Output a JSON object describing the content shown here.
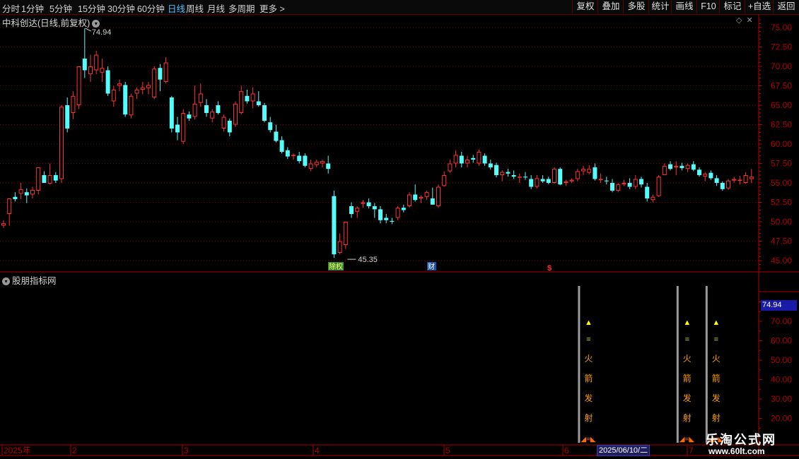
{
  "toolbar": {
    "periods": [
      "分时",
      "1分钟",
      "5分钟",
      "15分钟",
      "30分钟",
      "60分钟",
      "日线",
      "周线",
      "月线",
      "多周期",
      "更多"
    ],
    "active_period": "日线",
    "right_buttons": [
      "复权",
      "叠加",
      "多股",
      "统计",
      "画线",
      "F10",
      "标记",
      "+自选",
      "返回"
    ]
  },
  "main_chart": {
    "title": "中科创达(日线,前复权)"
  },
  "indicator_panel": {
    "title": "股朋指标网",
    "current_value_box": "74.94",
    "yticks": [
      "70.00",
      "60.00",
      "50.00",
      "40.00",
      "30.00",
      "20.00"
    ],
    "signal_text": [
      "▲",
      "=",
      "火",
      "箭",
      "发",
      "射"
    ],
    "signal_footer": "◢=◣"
  },
  "date_axis": {
    "labels": [
      "2025年",
      "2",
      "3",
      "4",
      "5",
      "6",
      "7"
    ],
    "cursor_date": "2025/06/10/二"
  },
  "watermark": {
    "main": "乐淘公式网",
    "url": "www.60lt.com"
  },
  "colors": {
    "up": "#ff3232",
    "down": "#54fcfc",
    "grid": "#8a0000",
    "axis": "#b00000",
    "text": "#c8c8c8",
    "signal_yellow": "#ffff00",
    "signal_orange": "#ffa000"
  },
  "chart_data": {
    "type": "candlestick",
    "title": "中科创达(日线,前复权)",
    "y_range": [
      44.0,
      76.5
    ],
    "yticks": [
      "75.00",
      "72.50",
      "70.00",
      "67.50",
      "65.00",
      "62.50",
      "60.00",
      "57.50",
      "55.00",
      "52.50",
      "50.00",
      "47.50",
      "45.00"
    ],
    "annotations": {
      "high_label": "74.94",
      "low_label": "45.35",
      "event_markers": [
        "除权",
        "财",
        "$"
      ]
    },
    "signals_at_index": [
      102,
      119,
      124
    ],
    "candles": [
      {
        "o": 49.5,
        "h": 50.2,
        "l": 49.2,
        "c": 49.8
      },
      {
        "o": 51.0,
        "h": 53.0,
        "l": 49.5,
        "c": 53.0
      },
      {
        "o": 53.2,
        "h": 53.8,
        "l": 52.6,
        "c": 52.9
      },
      {
        "o": 53.6,
        "h": 55.0,
        "l": 52.9,
        "c": 54.2
      },
      {
        "o": 53.8,
        "h": 54.3,
        "l": 52.4,
        "c": 53.4
      },
      {
        "o": 53.5,
        "h": 54.5,
        "l": 53.0,
        "c": 54.1
      },
      {
        "o": 54.0,
        "h": 57.0,
        "l": 53.5,
        "c": 57.0
      },
      {
        "o": 56.0,
        "h": 56.5,
        "l": 55.0,
        "c": 55.0
      },
      {
        "o": 54.9,
        "h": 57.5,
        "l": 54.8,
        "c": 56.0
      },
      {
        "o": 56.0,
        "h": 56.4,
        "l": 55.0,
        "c": 55.3
      },
      {
        "o": 55.5,
        "h": 65.0,
        "l": 55.0,
        "c": 64.8
      },
      {
        "o": 65.0,
        "h": 66.0,
        "l": 61.5,
        "c": 62.0
      },
      {
        "o": 64.0,
        "h": 66.8,
        "l": 63.2,
        "c": 66.2
      },
      {
        "o": 65.0,
        "h": 70.0,
        "l": 64.5,
        "c": 70.0
      },
      {
        "o": 71.0,
        "h": 74.9,
        "l": 68.5,
        "c": 69.5
      },
      {
        "o": 69.0,
        "h": 71.5,
        "l": 68.0,
        "c": 70.0
      },
      {
        "o": 69.5,
        "h": 72.0,
        "l": 69.0,
        "c": 71.5
      },
      {
        "o": 69.2,
        "h": 71.0,
        "l": 68.0,
        "c": 69.8
      },
      {
        "o": 69.5,
        "h": 70.0,
        "l": 66.2,
        "c": 66.5
      },
      {
        "o": 65.5,
        "h": 67.5,
        "l": 64.8,
        "c": 67.0
      },
      {
        "o": 67.5,
        "h": 68.3,
        "l": 66.8,
        "c": 67.8
      },
      {
        "o": 67.6,
        "h": 68.0,
        "l": 63.5,
        "c": 63.8
      },
      {
        "o": 63.7,
        "h": 66.5,
        "l": 63.3,
        "c": 66.2
      },
      {
        "o": 66.5,
        "h": 67.3,
        "l": 65.8,
        "c": 67.0
      },
      {
        "o": 67.0,
        "h": 68.0,
        "l": 66.4,
        "c": 67.3
      },
      {
        "o": 67.2,
        "h": 68.0,
        "l": 66.4,
        "c": 67.6
      },
      {
        "o": 66.0,
        "h": 70.0,
        "l": 65.8,
        "c": 69.7
      },
      {
        "o": 69.8,
        "h": 70.3,
        "l": 66.8,
        "c": 68.3
      },
      {
        "o": 68.0,
        "h": 71.2,
        "l": 67.8,
        "c": 70.5
      },
      {
        "o": 66.0,
        "h": 66.2,
        "l": 61.5,
        "c": 62.0
      },
      {
        "o": 62.5,
        "h": 63.5,
        "l": 60.5,
        "c": 61.5
      },
      {
        "o": 60.3,
        "h": 64.5,
        "l": 60.0,
        "c": 64.0
      },
      {
        "o": 63.8,
        "h": 64.2,
        "l": 63.0,
        "c": 63.3
      },
      {
        "o": 63.5,
        "h": 67.5,
        "l": 63.2,
        "c": 65.2
      },
      {
        "o": 65.3,
        "h": 67.8,
        "l": 64.8,
        "c": 66.5
      },
      {
        "o": 65.0,
        "h": 65.8,
        "l": 63.5,
        "c": 64.0
      },
      {
        "o": 63.3,
        "h": 64.5,
        "l": 62.8,
        "c": 64.2
      },
      {
        "o": 65.0,
        "h": 65.5,
        "l": 63.8,
        "c": 64.0
      },
      {
        "o": 62.0,
        "h": 63.8,
        "l": 61.6,
        "c": 63.5
      },
      {
        "o": 63.0,
        "h": 63.3,
        "l": 61.0,
        "c": 61.5
      },
      {
        "o": 62.5,
        "h": 65.5,
        "l": 62.2,
        "c": 65.2
      },
      {
        "o": 64.0,
        "h": 67.5,
        "l": 63.8,
        "c": 66.8
      },
      {
        "o": 66.2,
        "h": 67.0,
        "l": 65.2,
        "c": 65.5
      },
      {
        "o": 65.5,
        "h": 67.3,
        "l": 64.6,
        "c": 66.5
      },
      {
        "o": 65.5,
        "h": 66.8,
        "l": 64.8,
        "c": 65.0
      },
      {
        "o": 65.0,
        "h": 65.3,
        "l": 62.8,
        "c": 63.0
      },
      {
        "o": 62.8,
        "h": 63.5,
        "l": 61.5,
        "c": 61.8
      },
      {
        "o": 61.6,
        "h": 62.5,
        "l": 60.2,
        "c": 60.4
      },
      {
        "o": 60.5,
        "h": 61.0,
        "l": 58.8,
        "c": 59.0
      },
      {
        "o": 59.2,
        "h": 59.6,
        "l": 58.1,
        "c": 58.4
      },
      {
        "o": 58.5,
        "h": 58.8,
        "l": 58.0,
        "c": 58.6
      },
      {
        "o": 58.5,
        "h": 59.0,
        "l": 57.5,
        "c": 57.8
      },
      {
        "o": 58.5,
        "h": 58.8,
        "l": 57.0,
        "c": 57.2
      },
      {
        "o": 56.8,
        "h": 58.0,
        "l": 56.5,
        "c": 57.5
      },
      {
        "o": 57.3,
        "h": 58.0,
        "l": 57.0,
        "c": 57.7
      },
      {
        "o": 57.5,
        "h": 58.0,
        "l": 57.0,
        "c": 57.8
      },
      {
        "o": 57.5,
        "h": 58.5,
        "l": 56.2,
        "c": 56.8
      },
      {
        "o": 53.3,
        "h": 54.0,
        "l": 45.35,
        "c": 45.8
      },
      {
        "o": 46.0,
        "h": 48.5,
        "l": 45.8,
        "c": 47.5
      },
      {
        "o": 47.0,
        "h": 50.0,
        "l": 46.5,
        "c": 50.0
      },
      {
        "o": 52.0,
        "h": 52.5,
        "l": 50.5,
        "c": 51.0
      },
      {
        "o": 51.3,
        "h": 52.0,
        "l": 50.5,
        "c": 51.8
      },
      {
        "o": 52.3,
        "h": 52.8,
        "l": 51.8,
        "c": 52.5
      },
      {
        "o": 52.5,
        "h": 53.0,
        "l": 51.7,
        "c": 52.0
      },
      {
        "o": 52.0,
        "h": 52.4,
        "l": 50.5,
        "c": 51.6
      },
      {
        "o": 51.6,
        "h": 52.0,
        "l": 49.8,
        "c": 50.2
      },
      {
        "o": 50.5,
        "h": 51.0,
        "l": 49.8,
        "c": 50.2
      },
      {
        "o": 50.1,
        "h": 50.5,
        "l": 49.7,
        "c": 50.0
      },
      {
        "o": 50.5,
        "h": 52.0,
        "l": 50.2,
        "c": 51.8
      },
      {
        "o": 51.8,
        "h": 52.2,
        "l": 51.2,
        "c": 51.5
      },
      {
        "o": 52.0,
        "h": 53.8,
        "l": 51.8,
        "c": 53.5
      },
      {
        "o": 53.5,
        "h": 54.8,
        "l": 52.6,
        "c": 52.8
      },
      {
        "o": 53.0,
        "h": 53.4,
        "l": 52.4,
        "c": 53.2
      },
      {
        "o": 53.2,
        "h": 54.0,
        "l": 52.8,
        "c": 53.8
      },
      {
        "o": 53.0,
        "h": 54.4,
        "l": 52.9,
        "c": 52.2
      },
      {
        "o": 52.0,
        "h": 54.8,
        "l": 51.8,
        "c": 54.5
      },
      {
        "o": 54.6,
        "h": 56.5,
        "l": 54.5,
        "c": 56.0
      },
      {
        "o": 56.5,
        "h": 58.0,
        "l": 56.3,
        "c": 57.5
      },
      {
        "o": 57.5,
        "h": 59.2,
        "l": 57.0,
        "c": 58.6
      },
      {
        "o": 58.5,
        "h": 59.0,
        "l": 57.0,
        "c": 57.5
      },
      {
        "o": 57.5,
        "h": 58.5,
        "l": 57.0,
        "c": 58.0
      },
      {
        "o": 58.2,
        "h": 58.6,
        "l": 57.6,
        "c": 58.0
      },
      {
        "o": 57.5,
        "h": 59.3,
        "l": 57.2,
        "c": 59.0
      },
      {
        "o": 58.5,
        "h": 58.8,
        "l": 57.2,
        "c": 57.5
      },
      {
        "o": 57.5,
        "h": 58.0,
        "l": 56.7,
        "c": 57.0
      },
      {
        "o": 57.3,
        "h": 57.6,
        "l": 55.7,
        "c": 56.0
      },
      {
        "o": 56.0,
        "h": 56.6,
        "l": 55.2,
        "c": 56.4
      },
      {
        "o": 56.4,
        "h": 56.8,
        "l": 55.8,
        "c": 56.2
      },
      {
        "o": 56.0,
        "h": 56.6,
        "l": 55.5,
        "c": 55.8
      },
      {
        "o": 55.8,
        "h": 56.2,
        "l": 55.0,
        "c": 55.8
      },
      {
        "o": 55.8,
        "h": 56.4,
        "l": 55.4,
        "c": 55.7
      },
      {
        "o": 55.5,
        "h": 56.0,
        "l": 54.2,
        "c": 54.5
      },
      {
        "o": 54.5,
        "h": 56.0,
        "l": 54.3,
        "c": 55.6
      },
      {
        "o": 55.5,
        "h": 56.0,
        "l": 55.0,
        "c": 55.2
      },
      {
        "o": 55.5,
        "h": 55.8,
        "l": 54.8,
        "c": 55.0
      },
      {
        "o": 55.0,
        "h": 57.0,
        "l": 54.9,
        "c": 56.8
      },
      {
        "o": 56.8,
        "h": 57.0,
        "l": 54.7,
        "c": 54.8
      },
      {
        "o": 55.0,
        "h": 55.4,
        "l": 54.6,
        "c": 55.2
      },
      {
        "o": 55.2,
        "h": 55.6,
        "l": 55.0,
        "c": 55.4
      },
      {
        "o": 55.5,
        "h": 56.8,
        "l": 55.2,
        "c": 56.5
      },
      {
        "o": 56.5,
        "h": 57.2,
        "l": 56.0,
        "c": 56.8
      },
      {
        "o": 56.3,
        "h": 57.3,
        "l": 56.1,
        "c": 56.8
      },
      {
        "o": 57.0,
        "h": 57.5,
        "l": 55.3,
        "c": 55.5
      },
      {
        "o": 55.5,
        "h": 56.2,
        "l": 55.0,
        "c": 55.5
      },
      {
        "o": 55.3,
        "h": 55.8,
        "l": 54.8,
        "c": 55.2
      },
      {
        "o": 55.0,
        "h": 55.5,
        "l": 53.8,
        "c": 54.0
      },
      {
        "o": 54.0,
        "h": 55.0,
        "l": 53.8,
        "c": 54.8
      },
      {
        "o": 54.8,
        "h": 55.4,
        "l": 54.6,
        "c": 55.0
      },
      {
        "o": 55.0,
        "h": 55.6,
        "l": 54.2,
        "c": 54.5
      },
      {
        "o": 54.5,
        "h": 56.0,
        "l": 54.2,
        "c": 55.5
      },
      {
        "o": 55.5,
        "h": 55.8,
        "l": 54.4,
        "c": 54.8
      },
      {
        "o": 54.5,
        "h": 55.0,
        "l": 52.6,
        "c": 53.0
      },
      {
        "o": 52.8,
        "h": 53.5,
        "l": 52.5,
        "c": 53.2
      },
      {
        "o": 53.3,
        "h": 56.0,
        "l": 53.2,
        "c": 55.8
      },
      {
        "o": 56.0,
        "h": 57.5,
        "l": 56.0,
        "c": 57.2
      },
      {
        "o": 57.4,
        "h": 57.8,
        "l": 56.6,
        "c": 56.8
      },
      {
        "o": 57.0,
        "h": 57.8,
        "l": 56.0,
        "c": 57.2
      },
      {
        "o": 57.2,
        "h": 57.6,
        "l": 56.6,
        "c": 56.9
      },
      {
        "o": 56.8,
        "h": 57.5,
        "l": 56.4,
        "c": 57.3
      },
      {
        "o": 57.4,
        "h": 57.8,
        "l": 56.5,
        "c": 56.7
      },
      {
        "o": 56.7,
        "h": 57.0,
        "l": 55.8,
        "c": 56.0
      },
      {
        "o": 55.8,
        "h": 56.4,
        "l": 55.2,
        "c": 56.2
      },
      {
        "o": 56.3,
        "h": 56.6,
        "l": 55.4,
        "c": 55.6
      },
      {
        "o": 55.6,
        "h": 56.0,
        "l": 54.6,
        "c": 55.0
      },
      {
        "o": 55.0,
        "h": 55.2,
        "l": 54.0,
        "c": 54.2
      },
      {
        "o": 54.3,
        "h": 55.5,
        "l": 54.1,
        "c": 55.3
      },
      {
        "o": 55.3,
        "h": 55.8,
        "l": 55.0,
        "c": 55.5
      },
      {
        "o": 55.3,
        "h": 55.9,
        "l": 54.8,
        "c": 55.4
      },
      {
        "o": 55.0,
        "h": 56.4,
        "l": 54.9,
        "c": 56.0
      },
      {
        "o": 55.5,
        "h": 56.8,
        "l": 55.0,
        "c": 55.8
      }
    ]
  }
}
